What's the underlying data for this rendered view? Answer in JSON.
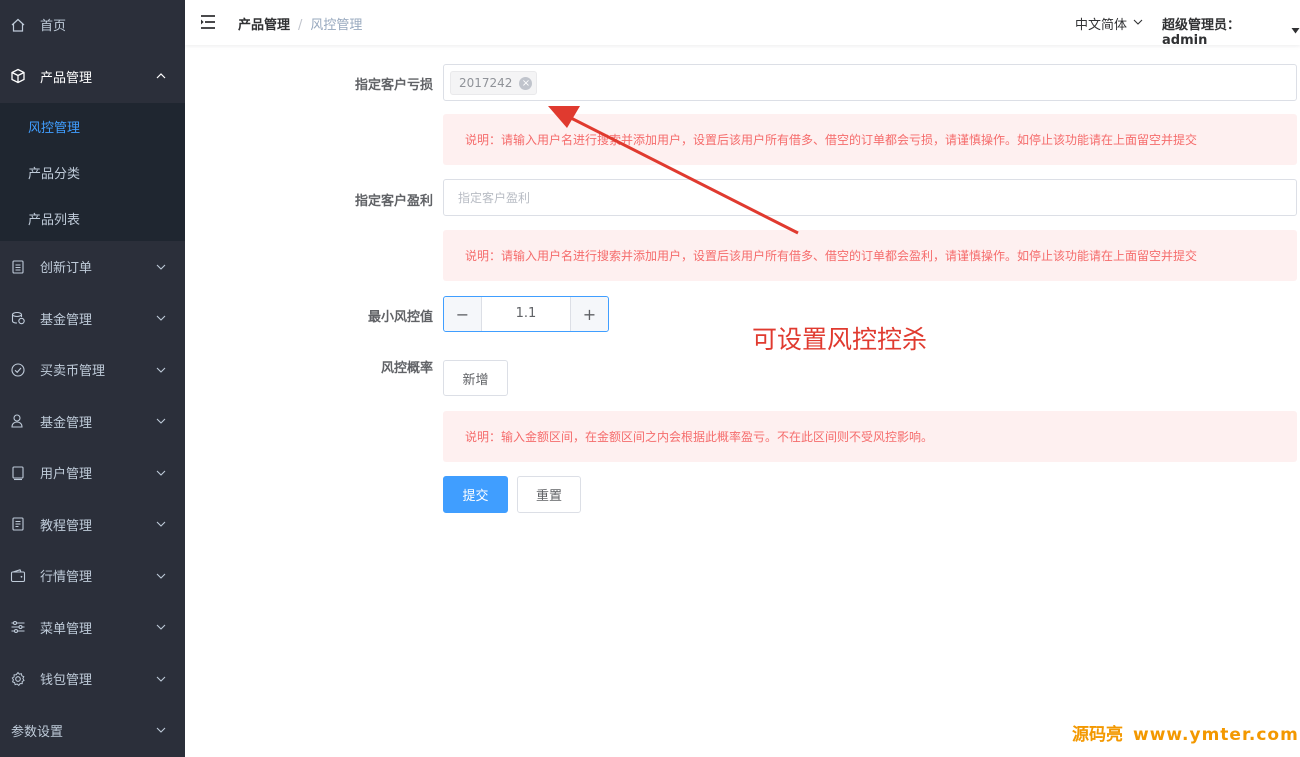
{
  "sidebar": {
    "items": [
      {
        "label": "首页",
        "icon": "home-icon"
      },
      {
        "label": "产品管理",
        "icon": "cube-icon",
        "open": true,
        "children": [
          {
            "label": "风控管理",
            "active": true
          },
          {
            "label": "产品分类"
          },
          {
            "label": "产品列表"
          }
        ]
      },
      {
        "label": "创新订单",
        "icon": "document-list-icon"
      },
      {
        "label": "基金管理",
        "icon": "coins-icon"
      },
      {
        "label": "买卖币管理",
        "icon": "circle-check-icon"
      },
      {
        "label": "基金管理",
        "icon": "user-icon"
      },
      {
        "label": "用户管理",
        "icon": "notebook-icon"
      },
      {
        "label": "教程管理",
        "icon": "document-icon"
      },
      {
        "label": "行情管理",
        "icon": "wallet-icon"
      },
      {
        "label": "菜单管理",
        "icon": "sliders-icon"
      },
      {
        "label": "钱包管理",
        "icon": "gear-icon"
      },
      {
        "label": "参数设置",
        "icon": ""
      }
    ]
  },
  "header": {
    "breadcrumb": [
      "产品管理",
      "风控管理"
    ],
    "breadcrumb_sep": "/",
    "language": "中文简体",
    "user": "超级管理员：admin"
  },
  "form": {
    "loss_label": "指定客户亏损",
    "loss_tag": "2017242",
    "loss_note": "说明：请输入用户名进行搜索并添加用户，设置后该用户所有借多、借空的订单都会亏损，请谨慎操作。如停止该功能请在上面留空并提交",
    "profit_label": "指定客户盈利",
    "profit_placeholder": "指定客户盈利",
    "profit_note": "说明：请输入用户名进行搜索并添加用户，设置后该用户所有借多、借空的订单都会盈利，请谨慎操作。如停止该功能请在上面留空并提交",
    "min_label": "最小风控值",
    "min_value": "1.1",
    "prob_label": "风控概率",
    "add_label": "新增",
    "prob_note": "说明：输入金额区间，在金额区间之内会根据此概率盈亏。不在此区间则不受风控影响。",
    "submit_label": "提交",
    "reset_label": "重置"
  },
  "annotation": "可设置风控控杀",
  "watermark": {
    "brand": "源码亮",
    "url": "www.ymter.com"
  },
  "colors": {
    "sidebar_bg": "#2b2f3a",
    "active": "#409eff",
    "alert_bg": "#fef0f0",
    "alert_text": "#f56c6c",
    "annotation": "#e03a2f",
    "watermark": "#f39800"
  }
}
